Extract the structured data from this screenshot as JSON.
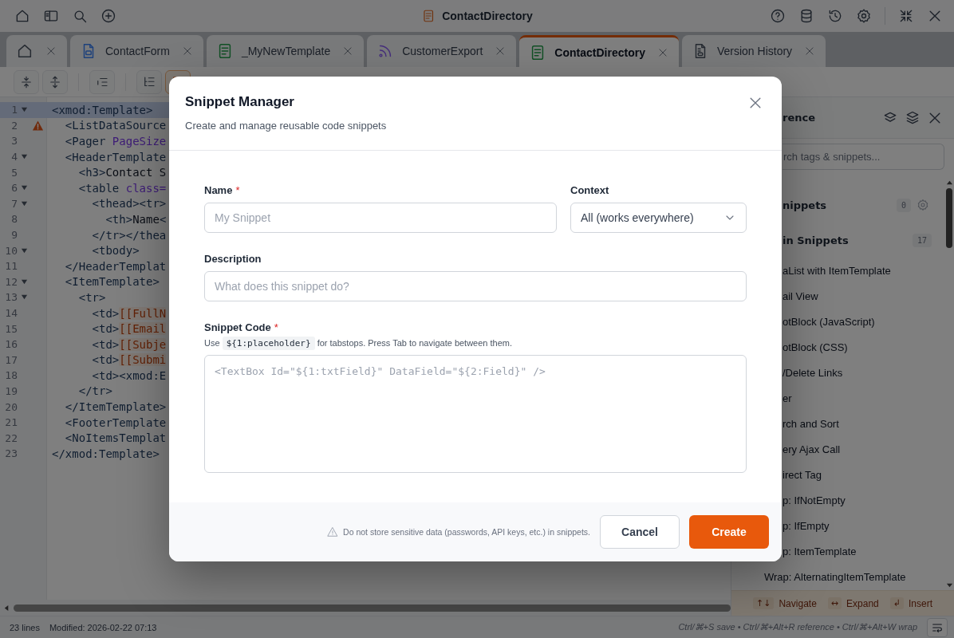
{
  "titlebar": {
    "title": "ContactDirectory"
  },
  "tabs": [
    {
      "kind": "home",
      "selected": false
    },
    {
      "kind": "form",
      "label": "ContactForm",
      "selected": false
    },
    {
      "kind": "template",
      "label": "_MyNewTemplate",
      "selected": false
    },
    {
      "kind": "feed",
      "label": "CustomerExport",
      "selected": false
    },
    {
      "kind": "template",
      "label": "ContactDirectory",
      "selected": true
    },
    {
      "kind": "history",
      "label": "Version History",
      "selected": false
    }
  ],
  "toolbar": [
    {
      "active": false
    },
    {
      "active": false
    },
    {
      "active": false
    },
    {
      "active": false
    },
    {
      "active": true
    }
  ],
  "editor": {
    "lines": [
      {
        "number": "1",
        "fold": true,
        "warning": false,
        "current": true,
        "tokens": [
          {
            "kind": "tag",
            "text": "<xmod:Template>"
          }
        ]
      },
      {
        "number": "2",
        "fold": false,
        "warning": true,
        "current": false,
        "tokens": [
          {
            "kind": "tag",
            "text": "  <ListDataSource"
          }
        ]
      },
      {
        "number": "3",
        "fold": false,
        "warning": false,
        "current": false,
        "tokens": [
          {
            "kind": "tag",
            "text": "  <Pager"
          },
          {
            "kind": "attr",
            "text": " PageSize"
          }
        ]
      },
      {
        "number": "4",
        "fold": true,
        "warning": false,
        "current": false,
        "tokens": [
          {
            "kind": "tag",
            "text": "  <HeaderTemplate"
          }
        ]
      },
      {
        "number": "5",
        "fold": false,
        "warning": false,
        "current": false,
        "tokens": [
          {
            "kind": "tag",
            "text": "    <h3>"
          },
          {
            "kind": "text",
            "text": "Contact S"
          }
        ]
      },
      {
        "number": "6",
        "fold": true,
        "warning": false,
        "current": false,
        "tokens": [
          {
            "kind": "tag",
            "text": "    <table"
          },
          {
            "kind": "attr",
            "text": " class="
          }
        ]
      },
      {
        "number": "7",
        "fold": true,
        "warning": false,
        "current": false,
        "tokens": [
          {
            "kind": "tag",
            "text": "      <thead><tr>"
          }
        ]
      },
      {
        "number": "8",
        "fold": false,
        "warning": false,
        "current": false,
        "tokens": [
          {
            "kind": "tag",
            "text": "        <th>"
          },
          {
            "kind": "text",
            "text": "Name"
          },
          {
            "kind": "tag",
            "text": "<"
          }
        ]
      },
      {
        "number": "9",
        "fold": false,
        "warning": false,
        "current": false,
        "tokens": [
          {
            "kind": "tag",
            "text": "      </tr></thea"
          }
        ]
      },
      {
        "number": "10",
        "fold": true,
        "warning": false,
        "current": false,
        "tokens": [
          {
            "kind": "tag",
            "text": "      <tbody>"
          }
        ]
      },
      {
        "number": "11",
        "fold": false,
        "warning": false,
        "current": false,
        "tokens": [
          {
            "kind": "tag",
            "text": "  </HeaderTemplat"
          }
        ]
      },
      {
        "number": "12",
        "fold": true,
        "warning": false,
        "current": false,
        "tokens": [
          {
            "kind": "tag",
            "text": "  <ItemTemplate>"
          }
        ]
      },
      {
        "number": "13",
        "fold": true,
        "warning": false,
        "current": false,
        "tokens": [
          {
            "kind": "tag",
            "text": "    <tr>"
          }
        ]
      },
      {
        "number": "14",
        "fold": false,
        "warning": false,
        "current": false,
        "tokens": [
          {
            "kind": "tag",
            "text": "      <td>"
          },
          {
            "kind": "field",
            "text": "[[FullN"
          }
        ]
      },
      {
        "number": "15",
        "fold": false,
        "warning": false,
        "current": false,
        "tokens": [
          {
            "kind": "tag",
            "text": "      <td>"
          },
          {
            "kind": "field",
            "text": "[[Email"
          }
        ]
      },
      {
        "number": "16",
        "fold": false,
        "warning": false,
        "current": false,
        "tokens": [
          {
            "kind": "tag",
            "text": "      <td>"
          },
          {
            "kind": "field",
            "text": "[[Subje"
          }
        ]
      },
      {
        "number": "17",
        "fold": false,
        "warning": false,
        "current": false,
        "tokens": [
          {
            "kind": "tag",
            "text": "      <td>"
          },
          {
            "kind": "field",
            "text": "[[Submi"
          }
        ]
      },
      {
        "number": "18",
        "fold": false,
        "warning": false,
        "current": false,
        "tokens": [
          {
            "kind": "tag",
            "text": "      <td><xmod:E"
          }
        ]
      },
      {
        "number": "19",
        "fold": false,
        "warning": false,
        "current": false,
        "tokens": [
          {
            "kind": "tag",
            "text": "    </tr>"
          }
        ]
      },
      {
        "number": "20",
        "fold": false,
        "warning": false,
        "current": false,
        "tokens": [
          {
            "kind": "tag",
            "text": "  </ItemTemplate>"
          }
        ]
      },
      {
        "number": "21",
        "fold": false,
        "warning": false,
        "current": false,
        "tokens": [
          {
            "kind": "tag",
            "text": "  <FooterTemplate"
          }
        ]
      },
      {
        "number": "22",
        "fold": false,
        "warning": false,
        "current": false,
        "tokens": [
          {
            "kind": "tag",
            "text": "  <NoItemsTemplat"
          }
        ]
      },
      {
        "number": "23",
        "fold": false,
        "warning": false,
        "current": false,
        "tokens": [
          {
            "kind": "tag",
            "text": "</xmod:Template>"
          }
        ]
      }
    ]
  },
  "reference": {
    "title": "rence",
    "search_placeholder": "rch tags & snippets...",
    "sections": [
      {
        "title": "nippets",
        "count": "0",
        "settings": true
      },
      {
        "title": "in Snippets",
        "count": "17",
        "settings": false,
        "items": [
          "aList with ItemTemplate",
          "ail View",
          "otBlock (JavaScript)",
          "otBlock (CSS)",
          "/Delete Links",
          "er",
          "rch and Sort",
          "ery Ajax Call",
          "irect Tag",
          "p: IfNotEmpty",
          "p: IfEmpty",
          "p: ItemTemplate",
          "Wrap: AlternatingItemTemplate"
        ]
      }
    ],
    "hints": [
      {
        "key": "↑↓",
        "label": "Navigate"
      },
      {
        "key": "↔",
        "label": "Expand"
      },
      {
        "key": "↲",
        "label": "Insert"
      }
    ]
  },
  "status_bar": {
    "lines": "23 lines",
    "modified": "Modified: 2026-02-22 07:13",
    "shortcuts": "Ctrl/⌘+S save • Ctrl/⌘+Alt+R reference • Ctrl/⌘+Alt+W wrap"
  },
  "dialog": {
    "title": "Snippet Manager",
    "subtitle": "Create and manage reusable code snippets",
    "name": {
      "label": "Name",
      "required_mark": "*",
      "placeholder": "My Snippet"
    },
    "context": {
      "label": "Context",
      "value": "All (works everywhere)"
    },
    "description": {
      "label": "Description",
      "placeholder": "What does this snippet do?"
    },
    "code": {
      "label": "Snippet Code",
      "required_mark": "*",
      "hint_before": "Use",
      "hint_code": "${1:placeholder}",
      "hint_after": "for tabstops. Press Tab to navigate between them.",
      "placeholder": "<TextBox Id=\"${1:txtField}\" DataField=\"${2:Field}\" />"
    },
    "warning": "Do not store sensitive data (passwords, API keys, etc.) in snippets.",
    "buttons": [
      {
        "kind": "secondary",
        "label": "Cancel"
      },
      {
        "kind": "primary",
        "label": "Create"
      }
    ]
  }
}
